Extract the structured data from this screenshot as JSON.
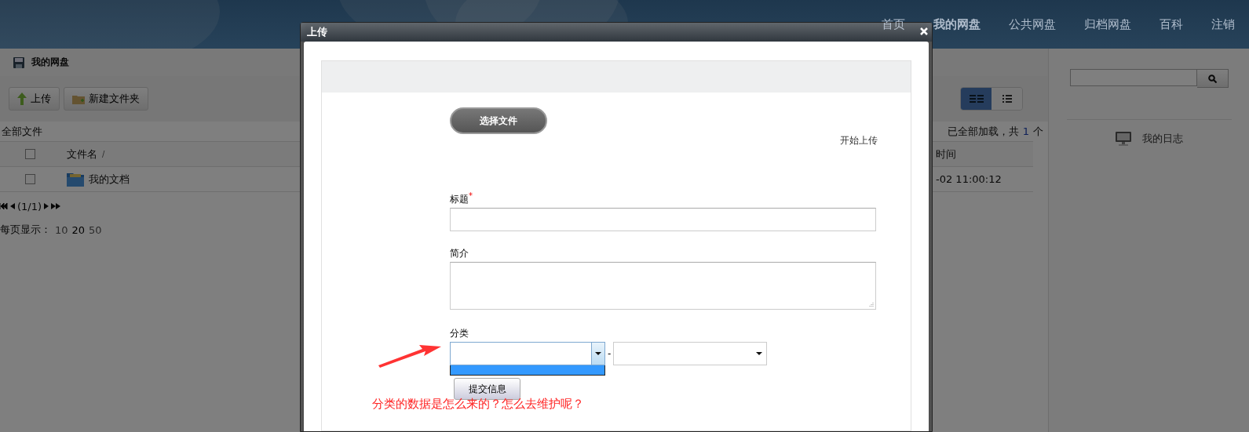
{
  "header": {
    "nav": [
      {
        "label": "首页",
        "selected": false
      },
      {
        "label": "我的网盘",
        "selected": true
      },
      {
        "label": "公共网盘",
        "selected": false
      },
      {
        "label": "归档网盘",
        "selected": false
      },
      {
        "label": "百科",
        "selected": false
      },
      {
        "label": "注销",
        "selected": false
      }
    ]
  },
  "breadcrumb": {
    "title": "我的网盘"
  },
  "toolbar": {
    "buttons": [
      {
        "kind": "upload",
        "label": "上传"
      },
      {
        "kind": "folder",
        "label": "新建文件夹"
      }
    ],
    "view_modes": [
      {
        "kind": "grid",
        "selected": true
      },
      {
        "kind": "list",
        "selected": false
      }
    ]
  },
  "files": {
    "path": "全部文件",
    "status": "已全部加载，共",
    "count": "1",
    "unit": "个",
    "header_checked": false,
    "name_column": "文件名",
    "sort_mark": "/",
    "time_column": "时间",
    "rows": [
      {
        "name": "我的文档",
        "time": "-02 11:00:12",
        "checked": false
      }
    ]
  },
  "pager": {
    "text": "(1/1)"
  },
  "page_size": {
    "label": "每页显示：",
    "options": [
      {
        "label": "10",
        "selected": false
      },
      {
        "label": "20",
        "selected": true
      },
      {
        "label": "50",
        "selected": false
      }
    ]
  },
  "sidebar": {
    "links": [
      "我的日志"
    ]
  },
  "dialog": {
    "title": "上传",
    "choose_button": "选择文件",
    "start_link": "开始上传",
    "fields": [
      {
        "kind": "input",
        "label": "标题",
        "required": true
      },
      {
        "kind": "textarea",
        "label": "简介",
        "required": false
      }
    ],
    "required_mark": "*",
    "category": {
      "label": "分类",
      "separator": "-",
      "dropdown_open": true
    },
    "submit": "提交信息"
  },
  "annotation": {
    "text": "分类的数据是怎么来的？怎么去维护呢？"
  }
}
